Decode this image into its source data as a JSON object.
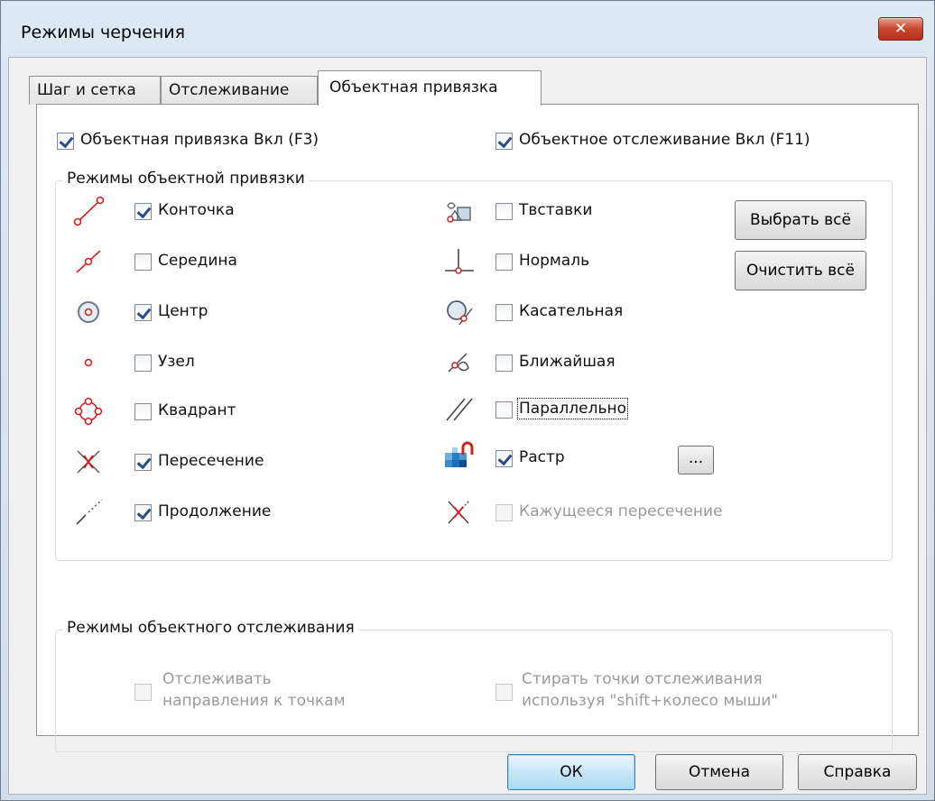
{
  "window": {
    "title": "Режимы черчения",
    "close_label": "✕"
  },
  "tabs": [
    {
      "label": "Шаг и сетка"
    },
    {
      "label": "Отслеживание"
    },
    {
      "label": "Объектная привязка"
    }
  ],
  "top_options": {
    "osnap_on": {
      "label": "Объектная привязка Вкл (F3)",
      "checked": true
    },
    "otrack_on": {
      "label": "Объектное отслеживание Вкл (F11)",
      "checked": true
    }
  },
  "osnap_group": {
    "title": "Режимы объектной привязки",
    "left": [
      {
        "label": "Конточка",
        "checked": true,
        "icon": "endpoint-icon"
      },
      {
        "label": "Середина",
        "checked": false,
        "icon": "midpoint-icon"
      },
      {
        "label": "Центр",
        "checked": true,
        "icon": "center-icon"
      },
      {
        "label": "Узел",
        "checked": false,
        "icon": "node-icon"
      },
      {
        "label": "Квадрант",
        "checked": false,
        "icon": "quadrant-icon"
      },
      {
        "label": "Пересечение",
        "checked": true,
        "icon": "intersection-icon"
      },
      {
        "label": "Продолжение",
        "checked": true,
        "icon": "extension-icon"
      }
    ],
    "right": [
      {
        "label": "Твставки",
        "checked": false,
        "icon": "insertion-icon"
      },
      {
        "label": "Нормаль",
        "checked": false,
        "icon": "perpendicular-icon"
      },
      {
        "label": "Касательная",
        "checked": false,
        "icon": "tangent-icon"
      },
      {
        "label": "Ближайшая",
        "checked": false,
        "icon": "nearest-icon"
      },
      {
        "label": "Параллельно",
        "checked": false,
        "icon": "parallel-icon"
      },
      {
        "label": "Растр",
        "checked": true,
        "icon": "raster-icon"
      },
      {
        "label": "Кажущееся пересечение",
        "checked": false,
        "icon": "apparent-intersection-icon",
        "disabled": true
      }
    ],
    "select_all_label": "Выбрать всё",
    "clear_all_label": "Очистить всё",
    "raster_more_label": "..."
  },
  "otrack_group": {
    "title": "Режимы объектного отслеживания",
    "track_directions": {
      "line1": "Отслеживать",
      "line2": "направления к точкам"
    },
    "erase_points": {
      "line1": "Стирать точки отслеживания",
      "line2": "используя \"shift+колесо мыши\""
    }
  },
  "footer": {
    "ok_label": "ОК",
    "cancel_label": "Отмена",
    "help_label": "Справка"
  },
  "colors": {
    "snap_red": "#d42020",
    "check_blue": "#2b4c8c"
  }
}
